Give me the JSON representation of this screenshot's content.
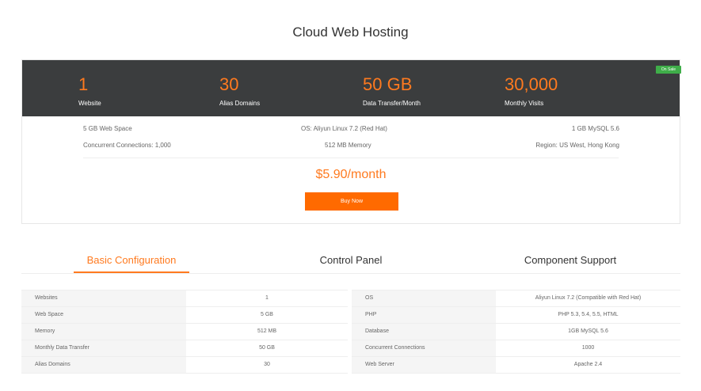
{
  "page": {
    "title": "Cloud Web Hosting"
  },
  "plan": {
    "badge": "On Sale",
    "stats": [
      {
        "value": "1",
        "label": "Website"
      },
      {
        "value": "30",
        "label": "Alias Domains"
      },
      {
        "value": "50 GB",
        "label": "Data Transfer/Month"
      },
      {
        "value": "30,000",
        "label": "Monthly Visits"
      }
    ],
    "specs": [
      "5 GB Web Space",
      "OS: Aliyun Linux 7.2 (Red Hat)",
      "1 GB MySQL 5.6",
      "Concurrent Connections: 1,000",
      "512 MB Memory",
      "Region: US West, Hong Kong"
    ],
    "price": "$5.90/month",
    "buy_label": "Buy Now"
  },
  "tabs": [
    {
      "label": "Basic Configuration",
      "active": true
    },
    {
      "label": "Control Panel",
      "active": false
    },
    {
      "label": "Component Support",
      "active": false
    }
  ],
  "config_left": [
    {
      "key": "Websites",
      "value": "1"
    },
    {
      "key": "Web Space",
      "value": "5 GB"
    },
    {
      "key": "Memory",
      "value": "512 MB"
    },
    {
      "key": "Monthly Data Transfer",
      "value": "50 GB"
    },
    {
      "key": "Alias Domains",
      "value": "30"
    }
  ],
  "config_right": [
    {
      "key": "OS",
      "value": "Aliyun Linux 7.2 (Compatible with Red Hat)"
    },
    {
      "key": "PHP",
      "value": "PHP 5.3, 5.4, 5.5, HTML"
    },
    {
      "key": "Database",
      "value": "1GB MySQL 5.6"
    },
    {
      "key": "Concurrent Connections",
      "value": "1000"
    },
    {
      "key": "Web Server",
      "value": "Apache 2.4"
    }
  ],
  "colors": {
    "accent": "#ff6a00",
    "banner": "#3b3d3e",
    "badge": "#3fae49"
  }
}
